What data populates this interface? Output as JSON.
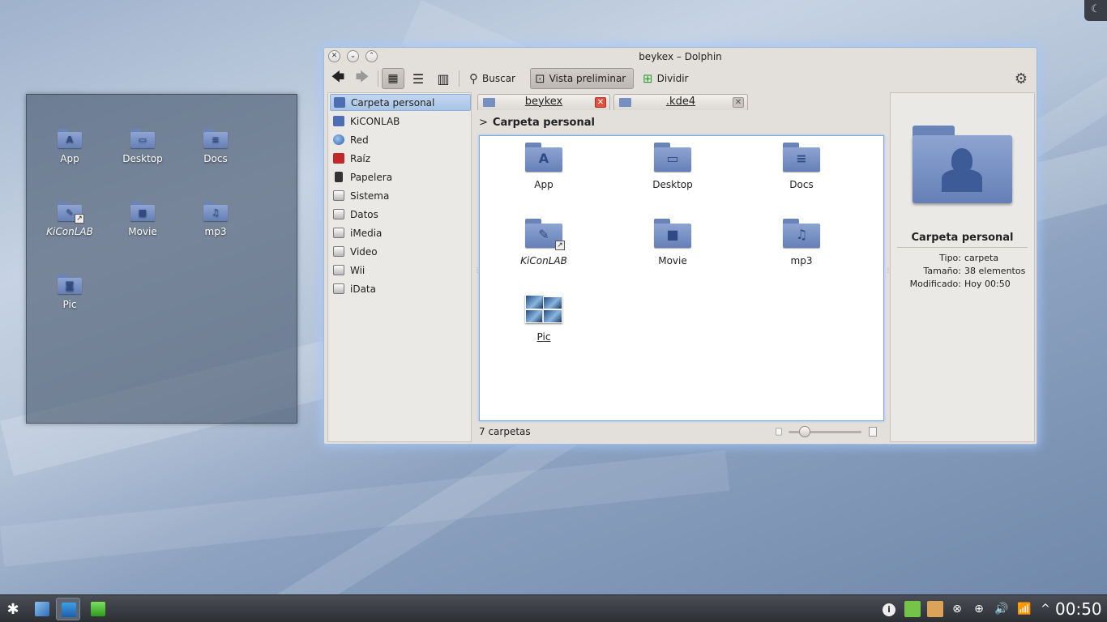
{
  "desktop": {
    "icons": [
      {
        "label": "App",
        "glyph": "A"
      },
      {
        "label": "Desktop",
        "glyph": "▭"
      },
      {
        "label": "Docs",
        "glyph": "≡"
      },
      {
        "label": "KiConLAB",
        "glyph": "✎"
      },
      {
        "label": "Movie",
        "glyph": "■"
      },
      {
        "label": "mp3",
        "glyph": "♫"
      },
      {
        "label": "Pic",
        "glyph": "◙"
      }
    ]
  },
  "window": {
    "title": "beykex – Dolphin",
    "buttons": {
      "close": "✕",
      "minimize": "⌄",
      "maximize": "⌃"
    }
  },
  "toolbar": {
    "back_icon": "back-arrow-icon",
    "forward_icon": "forward-arrow-icon",
    "search_label": "Buscar",
    "preview_label": "Vista preliminar",
    "split_label": "Dividir",
    "settings_icon": "gear-icon"
  },
  "places": {
    "items": [
      {
        "label": "Carpeta personal",
        "icon": "home",
        "selected": true
      },
      {
        "label": "KiCONLAB",
        "icon": "home"
      },
      {
        "label": "Red",
        "icon": "net"
      },
      {
        "label": "Raíz",
        "icon": "root"
      },
      {
        "label": "Papelera",
        "icon": "trash"
      },
      {
        "label": "Sistema",
        "icon": "drive"
      },
      {
        "label": "Datos",
        "icon": "drive"
      },
      {
        "label": "iMedia",
        "icon": "drive"
      },
      {
        "label": "Video",
        "icon": "drive"
      },
      {
        "label": "Wii",
        "icon": "drive"
      },
      {
        "label": "iData",
        "icon": "drive"
      }
    ]
  },
  "tabs": [
    {
      "label": "beykex",
      "active": true
    },
    {
      "label": ".kde4",
      "active": false
    }
  ],
  "breadcrumb": {
    "chevron": ">",
    "label": "Carpeta personal"
  },
  "files": [
    {
      "label": "App",
      "glyph": "A"
    },
    {
      "label": "Desktop",
      "glyph": "▭"
    },
    {
      "label": "Docs",
      "glyph": "≡"
    },
    {
      "label": "KiConLAB",
      "glyph": "✎"
    },
    {
      "label": "Movie",
      "glyph": "■"
    },
    {
      "label": "mp3",
      "glyph": "♫"
    },
    {
      "label": "Pic",
      "glyph": ""
    }
  ],
  "status": {
    "text": "7 carpetas",
    "zoom_level": 0.2
  },
  "info": {
    "name": "Carpeta personal",
    "rows": [
      {
        "key": "Tipo:",
        "value": "carpeta"
      },
      {
        "key": "Tamaño:",
        "value": "38 elementos"
      },
      {
        "key": "Modificado:",
        "value": "Hoy 00:50"
      }
    ]
  },
  "taskbar": {
    "clock": "00:50",
    "tray_info": "i",
    "tray_expand": "^"
  }
}
